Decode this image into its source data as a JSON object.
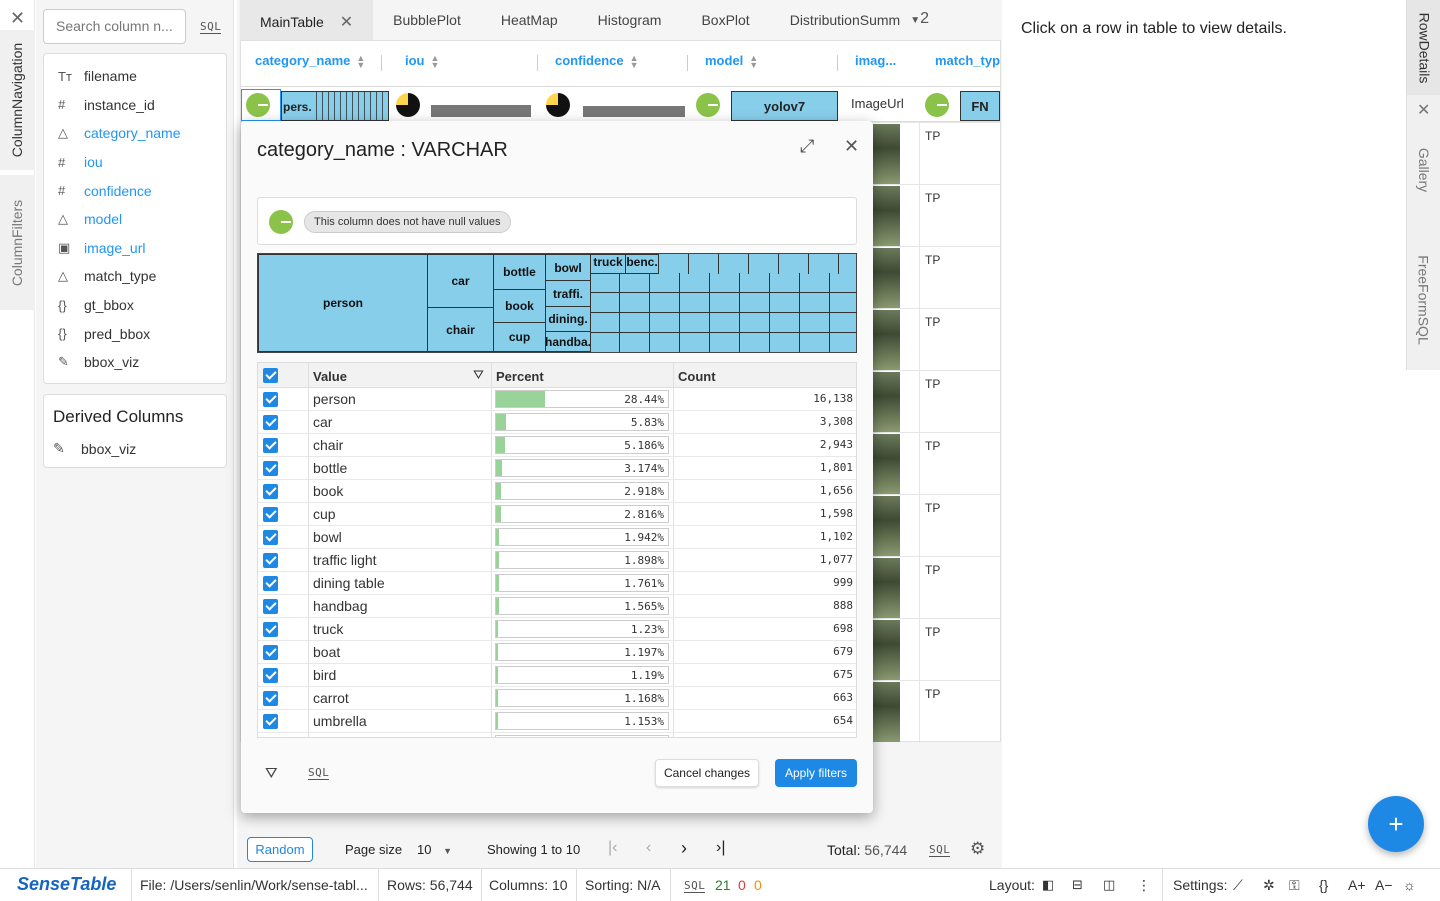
{
  "left_tabs": {
    "column_navigation": "ColumnNavigation",
    "column_filters": "ColumnFilters"
  },
  "colnav": {
    "search_placeholder": "Search column n...",
    "sql_label": "SQL",
    "columns": [
      {
        "icon": "text-icon",
        "glyph": "Tт",
        "label": "filename"
      },
      {
        "icon": "number-icon",
        "glyph": "#",
        "label": "instance_id"
      },
      {
        "icon": "category-icon",
        "glyph": "△",
        "label": "category_name"
      },
      {
        "icon": "number-icon",
        "glyph": "#",
        "label": "iou"
      },
      {
        "icon": "number-icon",
        "glyph": "#",
        "label": "confidence"
      },
      {
        "icon": "category-icon",
        "glyph": "△",
        "label": "model"
      },
      {
        "icon": "image-icon",
        "glyph": "▣",
        "label": "image_url"
      },
      {
        "icon": "category-icon",
        "glyph": "△",
        "label": "match_type"
      },
      {
        "icon": "json-icon",
        "glyph": "{}",
        "label": "gt_bbox"
      },
      {
        "icon": "json-icon",
        "glyph": "{}",
        "label": "pred_bbox"
      },
      {
        "icon": "brush-icon",
        "glyph": "✎",
        "label": "bbox_viz"
      }
    ],
    "derived_title": "Derived Columns",
    "derived_items": [
      {
        "label": "bbox_viz"
      }
    ]
  },
  "tabs": [
    {
      "label": "MainTable"
    },
    {
      "label": "BubblePlot"
    },
    {
      "label": "HeatMap"
    },
    {
      "label": "Histogram"
    },
    {
      "label": "BoxPlot"
    },
    {
      "label": "DistributionSumm"
    }
  ],
  "tabs_overflow_count": "2",
  "table": {
    "headers": [
      "category_name",
      "iou",
      "confidence",
      "model",
      "imag...",
      "match_typ"
    ],
    "summary": {
      "category_label": "pers.",
      "model_value": "yolov7",
      "image_value": "ImageUrl",
      "match_value": "FN"
    },
    "match_values": [
      "TP",
      "TP",
      "TP",
      "TP",
      "TP",
      "TP",
      "TP",
      "TP",
      "TP",
      "TP"
    ]
  },
  "modal": {
    "title": "category_name : VARCHAR",
    "null_text": "This column does not have null values",
    "treemap_labels": [
      "person",
      "car",
      "chair",
      "bottle",
      "book",
      "cup",
      "bowl",
      "traffi.",
      "dining.",
      "handba.",
      "truck",
      "benc."
    ],
    "grid_headers": {
      "value": "Value",
      "percent": "Percent",
      "count": "Count"
    },
    "rows": [
      {
        "value": "person",
        "percent": "28.44%",
        "pct": 0.2844,
        "count": "16,138"
      },
      {
        "value": "car",
        "percent": "5.83%",
        "pct": 0.0583,
        "count": "3,308"
      },
      {
        "value": "chair",
        "percent": "5.186%",
        "pct": 0.05186,
        "count": "2,943"
      },
      {
        "value": "bottle",
        "percent": "3.174%",
        "pct": 0.03174,
        "count": "1,801"
      },
      {
        "value": "book",
        "percent": "2.918%",
        "pct": 0.02918,
        "count": "1,656"
      },
      {
        "value": "cup",
        "percent": "2.816%",
        "pct": 0.02816,
        "count": "1,598"
      },
      {
        "value": "bowl",
        "percent": "1.942%",
        "pct": 0.01942,
        "count": "1,102"
      },
      {
        "value": "traffic light",
        "percent": "1.898%",
        "pct": 0.01898,
        "count": "1,077"
      },
      {
        "value": "dining table",
        "percent": "1.761%",
        "pct": 0.01761,
        "count": "999"
      },
      {
        "value": "handbag",
        "percent": "1.565%",
        "pct": 0.01565,
        "count": "888"
      },
      {
        "value": "truck",
        "percent": "1.23%",
        "pct": 0.0123,
        "count": "698"
      },
      {
        "value": "boat",
        "percent": "1.197%",
        "pct": 0.01197,
        "count": "679"
      },
      {
        "value": "bird",
        "percent": "1.19%",
        "pct": 0.0119,
        "count": "675"
      },
      {
        "value": "carrot",
        "percent": "1.168%",
        "pct": 0.01168,
        "count": "663"
      },
      {
        "value": "umbrella",
        "percent": "1.153%",
        "pct": 0.01153,
        "count": "654"
      }
    ],
    "sql_label": "SQL",
    "cancel_label": "Cancel changes",
    "apply_label": "Apply filters"
  },
  "details_text": "Click on a row in table to view details.",
  "right_tabs": {
    "row_details": "RowDetails",
    "gallery": "Gallery",
    "free_form_sql": "FreeFormSQL"
  },
  "pager": {
    "random_label": "Random",
    "page_size_label": "Page size",
    "page_size_value": "10",
    "showing": "Showing 1 to 10",
    "total_label": "Total:",
    "total_value": "56,744",
    "sql_label": "SQL"
  },
  "status": {
    "brand": "SenseTable",
    "file": "File: /Users/senlin/Work/sense-tabl...",
    "rows": "Rows: 56,744",
    "columns": "Columns: 10",
    "sorting": "Sorting: N/A",
    "sql_label": "SQL",
    "count_green": "21",
    "count_red": "0",
    "count_orange": "0",
    "layout_label": "Layout:",
    "settings_label": "Settings:"
  },
  "colors": {
    "accent": "#2196f3",
    "primary_button": "#1e88e5",
    "treemap": "#87ceeb",
    "bar": "#9ad39a",
    "green": "#8bc34a"
  }
}
